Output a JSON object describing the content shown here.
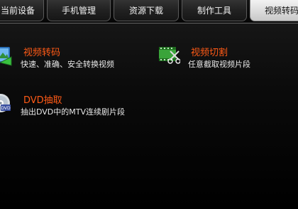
{
  "tabs": [
    {
      "label": "当前设备",
      "active": false
    },
    {
      "label": "手机管理",
      "active": false
    },
    {
      "label": "资源下载",
      "active": false
    },
    {
      "label": "制作工具",
      "active": false
    },
    {
      "label": "视频转码",
      "active": true
    }
  ],
  "features": [
    {
      "title": "视频转码",
      "desc": "快速、准确、安全转换视频",
      "icon": "video-convert-icon"
    },
    {
      "title": "视频切割",
      "desc": "任意截取视频片段",
      "icon": "video-cut-icon"
    },
    {
      "title": "DVD抽取",
      "desc": "抽出DVD中的MTV连续剧片段",
      "icon": "dvd-icon"
    }
  ],
  "colors": {
    "title": "#ff5a16",
    "desc": "#e8e8e8",
    "background": "#000000",
    "active_tab": "#e6e6e6"
  }
}
